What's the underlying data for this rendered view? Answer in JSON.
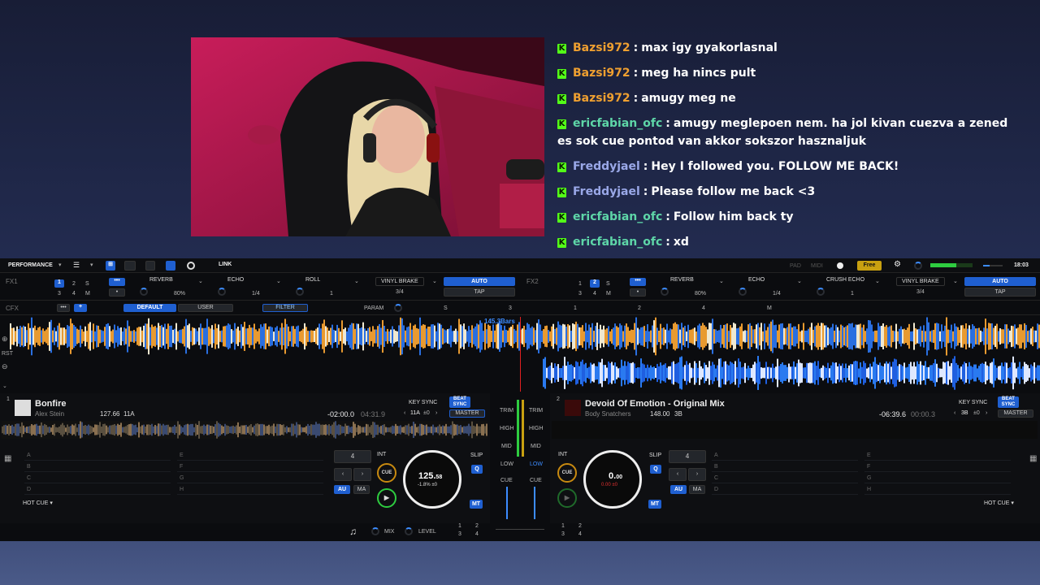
{
  "chat": [
    {
      "user": "Bazsi972",
      "color": "#f0a030",
      "text": "max igy gyakorlasnal"
    },
    {
      "user": "Bazsi972",
      "color": "#f0a030",
      "text": "meg ha nincs pult"
    },
    {
      "user": "Bazsi972",
      "color": "#f0a030",
      "text": "amugy meg ne"
    },
    {
      "user": "ericfabian_ofc",
      "color": "#5ed6a8",
      "text": "amugy meglepoen nem. ha jol kivan cuezva a zened es sok cue pontod van akkor sokszor hasznaljuk"
    },
    {
      "user": "Freddyjael",
      "color": "#9aa8e8",
      "text": "Hey I followed you. FOLLOW ME BACK!"
    },
    {
      "user": "Freddyjael",
      "color": "#9aa8e8",
      "text": "Please follow me back <3"
    },
    {
      "user": "ericfabian_ofc",
      "color": "#5ed6a8",
      "text": "Follow him back ty"
    },
    {
      "user": "ericfabian_ofc",
      "color": "#5ed6a8",
      "text": "xd"
    }
  ],
  "sep": ":",
  "kick_icon": "K",
  "topbar": {
    "mode": "PERFORMANCE",
    "link": "LINK",
    "pad": "PAD",
    "midi": "MIDI",
    "free": "Free",
    "clock": "18:03"
  },
  "fx1": {
    "label": "FX1",
    "n1": "1",
    "n2": "2",
    "n3": "3",
    "n4": "4",
    "s": "S",
    "m": "M",
    "dots": "•••",
    "dot": "•",
    "slots": [
      "REVERB",
      "ECHO",
      "ROLL",
      "VINYL BRAKE"
    ],
    "p1": "80%",
    "p2": "1/4",
    "p3": "1",
    "p4": "3/4",
    "auto": "AUTO",
    "tap": "TAP"
  },
  "fx2": {
    "label": "FX2",
    "n1": "1",
    "n2": "2",
    "n3": "3",
    "n4": "4",
    "s": "S",
    "m": "M",
    "dots": "•••",
    "dot": "•",
    "slots": [
      "REVERB",
      "ECHO",
      "CRUSH ECHO",
      "VINYL BRAKE"
    ],
    "p1": "80%",
    "p2": "1/4",
    "p3": "1",
    "p4": "3/4",
    "auto": "AUTO",
    "tap": "TAP"
  },
  "cfx": {
    "label": "CFX",
    "dots": "•••",
    "plus": "+",
    "default": "DEFAULT",
    "user": "USER",
    "filter": "FILTER",
    "param": "PARAM",
    "s": "S",
    "k3": "3",
    "k1": "1",
    "k2": "2",
    "k4": "4",
    "m": "M"
  },
  "wave": {
    "bars": "145.3Bars",
    "rst": "RST"
  },
  "deck1": {
    "num": "1",
    "title": "Bonfire",
    "artist": "Alex Stein",
    "bpm": "127.66",
    "key": "11A",
    "remain": "-02:00.0",
    "elapsed": "04:31.9",
    "keysync": "KEY SYNC",
    "beatsync": "BEAT SYNC",
    "keyval": "11A",
    "keyoff": "±0",
    "master": "MASTER",
    "loop": "4",
    "int": "INT",
    "slip": "SLIP",
    "cue": "CUE",
    "q": "Q",
    "au": "AU",
    "ma": "MA",
    "mt": "MT",
    "tempo": "125.",
    "tempo_dec": "58",
    "pitch": "-1.8%",
    "pitch2": "±0",
    "hotcue": "HOT CUE",
    "pads": [
      "A",
      "B",
      "C",
      "D",
      "E",
      "F",
      "G",
      "H"
    ]
  },
  "deck2": {
    "num": "2",
    "title": "Devoid Of Emotion - Original Mix",
    "artist": "Body Snatchers",
    "bpm": "148.00",
    "key": "3B",
    "remain": "-06:39.6",
    "elapsed": "00:00.3",
    "keysync": "KEY SYNC",
    "beatsync": "BEAT SYNC",
    "keyval": "3B",
    "keyoff": "±0",
    "master": "MASTER",
    "loop": "4",
    "int": "INT",
    "slip": "SLIP",
    "cue": "CUE",
    "q": "Q",
    "au": "AU",
    "ma": "MA",
    "mt": "MT",
    "tempo": "0.",
    "tempo_dec": "00",
    "pitch": "0.00",
    "pitch2": "±0",
    "hotcue": "HOT CUE",
    "pads": [
      "A",
      "B",
      "C",
      "D",
      "E",
      "F",
      "G",
      "H"
    ]
  },
  "mixer": {
    "trim": "TRIM",
    "high": "HIGH",
    "mid": "MID",
    "low": "LOW",
    "cue": "CUE"
  },
  "bottom": {
    "mix": "MIX",
    "level": "LEVEL",
    "n1": "1",
    "n2": "2",
    "n3": "3",
    "n4": "4"
  }
}
